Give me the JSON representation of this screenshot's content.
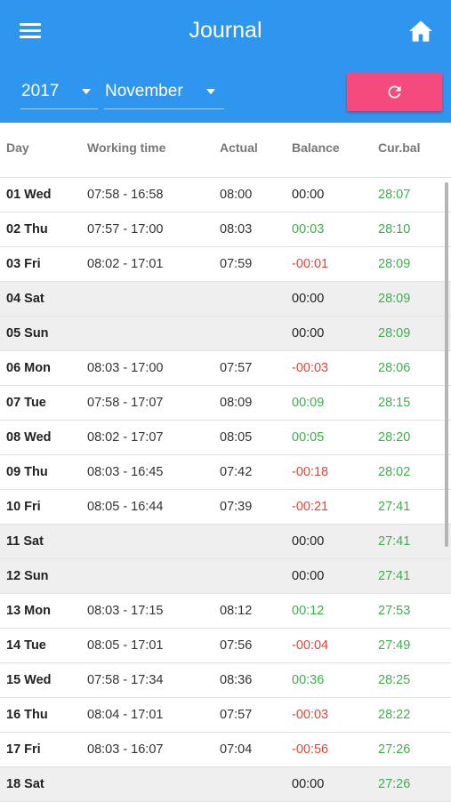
{
  "app": {
    "title": "Journal"
  },
  "filters": {
    "year": "2017",
    "month": "November"
  },
  "colors": {
    "primary": "#2f96f0",
    "accent": "#f44a7d",
    "positive": "#3fae4a",
    "negative": "#e0453a",
    "neutral": "#222222"
  },
  "icons": {
    "menu": "hamburger-menu",
    "home": "home",
    "refresh": "refresh"
  },
  "table": {
    "headers": {
      "day": "Day",
      "working_time": "Working time",
      "actual": "Actual",
      "balance": "Balance",
      "cur_bal": "Cur.bal"
    },
    "rows": [
      {
        "day": "01 Wed",
        "working_time": "07:58 - 16:58",
        "actual": "08:00",
        "balance": "00:00",
        "cur_bal": "28:07",
        "weekend": false,
        "balance_sign": "zero"
      },
      {
        "day": "02 Thu",
        "working_time": "07:57 - 17:00",
        "actual": "08:03",
        "balance": "00:03",
        "cur_bal": "28:10",
        "weekend": false,
        "balance_sign": "positive"
      },
      {
        "day": "03 Fri",
        "working_time": "08:02 - 17:01",
        "actual": "07:59",
        "balance": "-00:01",
        "cur_bal": "28:09",
        "weekend": false,
        "balance_sign": "negative"
      },
      {
        "day": "04 Sat",
        "working_time": "",
        "actual": "",
        "balance": "00:00",
        "cur_bal": "28:09",
        "weekend": true,
        "balance_sign": "zero"
      },
      {
        "day": "05 Sun",
        "working_time": "",
        "actual": "",
        "balance": "00:00",
        "cur_bal": "28:09",
        "weekend": true,
        "balance_sign": "zero"
      },
      {
        "day": "06 Mon",
        "working_time": "08:03 - 17:00",
        "actual": "07:57",
        "balance": "-00:03",
        "cur_bal": "28:06",
        "weekend": false,
        "balance_sign": "negative"
      },
      {
        "day": "07 Tue",
        "working_time": "07:58 - 17:07",
        "actual": "08:09",
        "balance": "00:09",
        "cur_bal": "28:15",
        "weekend": false,
        "balance_sign": "positive"
      },
      {
        "day": "08 Wed",
        "working_time": "08:02 - 17:07",
        "actual": "08:05",
        "balance": "00:05",
        "cur_bal": "28:20",
        "weekend": false,
        "balance_sign": "positive"
      },
      {
        "day": "09 Thu",
        "working_time": "08:03 - 16:45",
        "actual": "07:42",
        "balance": "-00:18",
        "cur_bal": "28:02",
        "weekend": false,
        "balance_sign": "negative"
      },
      {
        "day": "10 Fri",
        "working_time": "08:05 - 16:44",
        "actual": "07:39",
        "balance": "-00:21",
        "cur_bal": "27:41",
        "weekend": false,
        "balance_sign": "negative"
      },
      {
        "day": "11 Sat",
        "working_time": "",
        "actual": "",
        "balance": "00:00",
        "cur_bal": "27:41",
        "weekend": true,
        "balance_sign": "zero"
      },
      {
        "day": "12 Sun",
        "working_time": "",
        "actual": "",
        "balance": "00:00",
        "cur_bal": "27:41",
        "weekend": true,
        "balance_sign": "zero"
      },
      {
        "day": "13 Mon",
        "working_time": "08:03 - 17:15",
        "actual": "08:12",
        "balance": "00:12",
        "cur_bal": "27:53",
        "weekend": false,
        "balance_sign": "positive"
      },
      {
        "day": "14 Tue",
        "working_time": "08:05 - 17:01",
        "actual": "07:56",
        "balance": "-00:04",
        "cur_bal": "27:49",
        "weekend": false,
        "balance_sign": "negative"
      },
      {
        "day": "15 Wed",
        "working_time": "07:58 - 17:34",
        "actual": "08:36",
        "balance": "00:36",
        "cur_bal": "28:25",
        "weekend": false,
        "balance_sign": "positive"
      },
      {
        "day": "16 Thu",
        "working_time": "08:04 - 17:01",
        "actual": "07:57",
        "balance": "-00:03",
        "cur_bal": "28:22",
        "weekend": false,
        "balance_sign": "negative"
      },
      {
        "day": "17 Fri",
        "working_time": "08:03 - 16:07",
        "actual": "07:04",
        "balance": "-00:56",
        "cur_bal": "27:26",
        "weekend": false,
        "balance_sign": "negative"
      },
      {
        "day": "18 Sat",
        "working_time": "",
        "actual": "",
        "balance": "00:00",
        "cur_bal": "27:26",
        "weekend": true,
        "balance_sign": "zero"
      }
    ]
  }
}
